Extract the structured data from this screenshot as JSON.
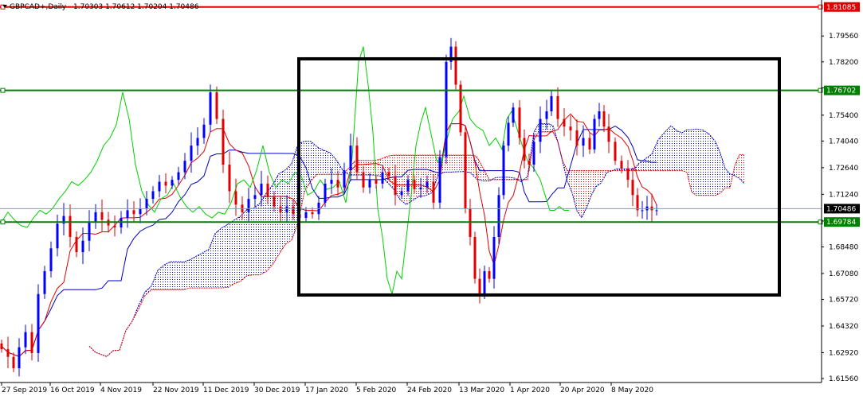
{
  "header": {
    "symbol_label": "GBPCAD+,Daily",
    "ohlc_label": "1.70303 1.70612 1.70204 1.70486"
  },
  "chart_data": {
    "type": "candlestick",
    "symbol": "GBPCAD+",
    "timeframe": "Daily",
    "ohlc": {
      "open": 1.70303,
      "high": 1.70612,
      "low": 1.70204,
      "close": 1.70486
    },
    "ylim": [
      1.6156,
      1.812
    ],
    "y_ticks": [
      "1.79560",
      "1.78200",
      "1.76840",
      "1.75400",
      "1.74040",
      "1.72640",
      "1.71240",
      "1.69840",
      "1.68480",
      "1.67080",
      "1.65720",
      "1.64320",
      "1.62920",
      "1.61560"
    ],
    "x_labels": [
      "27 Sep 2019",
      "16 Oct 2019",
      "4 Nov 2019",
      "22 Nov 2019",
      "11 Dec 2019",
      "30 Dec 2019",
      "17 Jan 2020",
      "5 Feb 2020",
      "24 Feb 2020",
      "13 Mar 2020",
      "1 Apr 2020",
      "20 Apr 2020",
      "8 May 2020"
    ],
    "levels": [
      {
        "label": "1.81085",
        "value": 1.81085,
        "color": "#e00000"
      },
      {
        "label": "1.76702",
        "value": 1.76702,
        "color": "#008000"
      },
      {
        "label": "1.69784",
        "value": 1.69784,
        "color": "#008000"
      }
    ],
    "current_price": {
      "label": "1.70486",
      "value": 1.70486
    },
    "series": [
      {
        "name": "price",
        "role": "candles",
        "points": [
          [
            0,
            1.631
          ],
          [
            8,
            1.627
          ],
          [
            15,
            1.621
          ],
          [
            22,
            1.632
          ],
          [
            30,
            1.64
          ],
          [
            38,
            1.629
          ],
          [
            46,
            1.66
          ],
          [
            54,
            1.672
          ],
          [
            62,
            1.684
          ],
          [
            70,
            1.697
          ],
          [
            78,
            1.701
          ],
          [
            86,
            1.69
          ],
          [
            94,
            1.682
          ],
          [
            102,
            1.688
          ],
          [
            110,
            1.698
          ],
          [
            118,
            1.703
          ],
          [
            126,
            1.699
          ],
          [
            134,
            1.696
          ],
          [
            142,
            1.695
          ],
          [
            150,
            1.7
          ],
          [
            158,
            1.704
          ],
          [
            166,
            1.702
          ],
          [
            174,
            1.705
          ],
          [
            182,
            1.71
          ],
          [
            190,
            1.714
          ],
          [
            198,
            1.719
          ],
          [
            206,
            1.717
          ],
          [
            214,
            1.72
          ],
          [
            222,
            1.724
          ],
          [
            230,
            1.73
          ],
          [
            238,
            1.738
          ],
          [
            246,
            1.742
          ],
          [
            254,
            1.749
          ],
          [
            262,
            1.766
          ],
          [
            270,
            1.752
          ],
          [
            278,
            1.728
          ],
          [
            286,
            1.714
          ],
          [
            294,
            1.707
          ],
          [
            302,
            1.703
          ],
          [
            310,
            1.71
          ],
          [
            318,
            1.712
          ],
          [
            326,
            1.718
          ],
          [
            334,
            1.711
          ],
          [
            342,
            1.706
          ],
          [
            350,
            1.703
          ],
          [
            358,
            1.706
          ],
          [
            366,
            1.702
          ],
          [
            374,
            1.7
          ],
          [
            382,
            1.703
          ],
          [
            390,
            1.702
          ],
          [
            398,
            1.708
          ],
          [
            406,
            1.718
          ],
          [
            414,
            1.72
          ],
          [
            422,
            1.716
          ],
          [
            430,
            1.725
          ],
          [
            438,
            1.738
          ],
          [
            446,
            1.724
          ],
          [
            454,
            1.716
          ],
          [
            462,
            1.72
          ],
          [
            470,
            1.718
          ],
          [
            478,
            1.724
          ],
          [
            486,
            1.722
          ],
          [
            494,
            1.712
          ],
          [
            502,
            1.714
          ],
          [
            510,
            1.72
          ],
          [
            518,
            1.715
          ],
          [
            526,
            1.716
          ],
          [
            534,
            1.719
          ],
          [
            542,
            1.708
          ],
          [
            550,
            1.732
          ],
          [
            558,
            1.782
          ],
          [
            564,
            1.79
          ],
          [
            570,
            1.77
          ],
          [
            576,
            1.745
          ],
          [
            582,
            1.705
          ],
          [
            588,
            1.69
          ],
          [
            594,
            1.668
          ],
          [
            600,
            1.66
          ],
          [
            606,
            1.672
          ],
          [
            612,
            1.668
          ],
          [
            618,
            1.69
          ],
          [
            624,
            1.712
          ],
          [
            630,
            1.738
          ],
          [
            636,
            1.75
          ],
          [
            642,
            1.758
          ],
          [
            650,
            1.742
          ],
          [
            656,
            1.73
          ],
          [
            662,
            1.728
          ],
          [
            668,
            1.74
          ],
          [
            676,
            1.752
          ],
          [
            684,
            1.756
          ],
          [
            690,
            1.764
          ],
          [
            698,
            1.752
          ],
          [
            706,
            1.748
          ],
          [
            714,
            1.746
          ],
          [
            722,
            1.738
          ],
          [
            730,
            1.742
          ],
          [
            738,
            1.736
          ],
          [
            744,
            1.752
          ],
          [
            750,
            1.756
          ],
          [
            756,
            1.748
          ],
          [
            762,
            1.74
          ],
          [
            770,
            1.73
          ],
          [
            778,
            1.726
          ],
          [
            786,
            1.72
          ],
          [
            792,
            1.712
          ],
          [
            798,
            1.704
          ],
          [
            804,
            1.704
          ],
          [
            810,
            1.706
          ],
          [
            816,
            1.704
          ],
          [
            822,
            1.704
          ]
        ]
      },
      {
        "name": "tenkan-sen",
        "color": "#e00000"
      },
      {
        "name": "kijun-sen",
        "color": "#0000c0"
      },
      {
        "name": "chikou-span",
        "color": "#00d000"
      },
      {
        "name": "senkou-span-a",
        "color": "#0000c0"
      },
      {
        "name": "senkou-span-b",
        "color": "#e00000"
      }
    ],
    "highlight_box": {
      "x_from": "17 Jan 2020",
      "x_to": "8 May 2020+",
      "y_from": 1.6595,
      "y_to": 1.7836
    },
    "grid": false,
    "colors": {
      "bull": "#0000ff",
      "bear": "#e00000",
      "background": "#ffffff",
      "axis": "#000000"
    }
  }
}
